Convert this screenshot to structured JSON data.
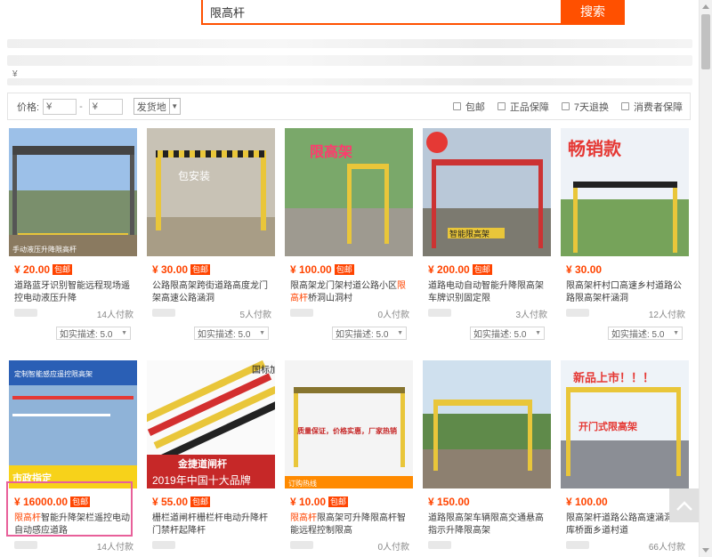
{
  "search": {
    "query": "限高杆",
    "button_label": "搜索"
  },
  "stray": {
    "yen_symbol": "¥"
  },
  "filter": {
    "price_label": "价格:",
    "min_placeholder": "¥",
    "dash": "-",
    "max_placeholder": "¥",
    "ship_from_label": "发货地",
    "checkboxes": [
      "包邮",
      "正品保障",
      "7天退换",
      "消费者保障"
    ]
  },
  "colors": {
    "accent": "#ff5000",
    "price": "#ff4400",
    "highlight_box": "#e8609a"
  },
  "products": [
    {
      "price": "¥ 20.00",
      "tag": "包邮",
      "title_pre": "",
      "title_hl": "",
      "title_post": "道路蓝牙识别智能远程现场遥控电动液压升降",
      "buyers": "14人付款",
      "rating": "如实描述: 5.0",
      "img_text": "手动液压升降限高杆"
    },
    {
      "price": "¥ 30.00",
      "tag": "包邮",
      "title_pre": "",
      "title_hl": "",
      "title_post": "公路限高架跨街道路高度龙门架高速公路涵洞",
      "buyers": "5人付款",
      "rating": "如实描述: 5.0",
      "img_text": "包安装"
    },
    {
      "price": "¥ 100.00",
      "tag": "包邮",
      "title_pre": "限高架龙门架村道公路小区",
      "title_hl": "限高杆",
      "title_post": "桥洞山洞村",
      "buyers": "0人付款",
      "rating": "如实描述: 5.0",
      "img_text": "限高架"
    },
    {
      "price": "¥ 200.00",
      "tag": "包邮",
      "title_pre": "",
      "title_hl": "",
      "title_post": "道路电动自动智能升降限高架车牌识别固定限",
      "buyers": "3人付款",
      "rating": "如实描述: 5.0",
      "img_text": "智能限高架"
    },
    {
      "price": "¥ 30.00",
      "tag": "",
      "title_pre": "",
      "title_hl": "",
      "title_post": "限高架杆村口高速乡村道路公路限高架杆涵洞",
      "buyers": "12人付款",
      "rating": "如实描述: 5.0",
      "img_text": "畅销款"
    },
    {
      "price": "¥ 16000.00",
      "tag": "包邮",
      "title_pre": "",
      "title_hl": "限高杆",
      "title_post": "智能升降架栏遥控电动自动感应道路",
      "buyers": "14人付款",
      "rating": "",
      "img_text": "定制智能感应遥控限高架",
      "img_text2": "市政指定"
    },
    {
      "price": "¥ 55.00",
      "tag": "包邮",
      "title_pre": "",
      "title_hl": "",
      "title_post": "栅栏道闸杆栅栏杆电动升降杆门禁杆起降杆",
      "buyers": "",
      "rating": "",
      "img_text": "金捷道闸杆",
      "img_text2": "2019年中国十大品牌",
      "img_text3": "国标加厚"
    },
    {
      "price": "¥ 10.00",
      "tag": "包邮",
      "title_pre": "",
      "title_hl": "限高杆",
      "title_post": "限高架可升降限高杆智能远程控制限高",
      "buyers": "0人付款",
      "rating": "",
      "img_text": "质量保证，价格实惠，厂家热销",
      "img_text2": "订购热线"
    },
    {
      "price": "¥ 150.00",
      "tag": "",
      "title_pre": "",
      "title_hl": "",
      "title_post": "道路限高架车辆限高交通悬高指示升降限高架",
      "buyers": "",
      "rating": "",
      "img_text": ""
    },
    {
      "price": "¥ 100.00",
      "tag": "",
      "title_pre": "",
      "title_hl": "",
      "title_post": "限高架杆道路公路高速涵洞车库桥面乡道村道",
      "buyers": "66人付款",
      "rating": "",
      "img_text": "新品上市！！！",
      "img_text2": "开门式限高架"
    }
  ]
}
